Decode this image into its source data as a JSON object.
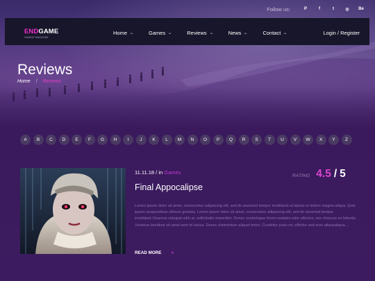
{
  "social": {
    "follow_label": "Follow us:",
    "icons": [
      {
        "name": "pinterest-icon",
        "glyph": "P"
      },
      {
        "name": "facebook-icon",
        "glyph": "f"
      },
      {
        "name": "twitter-icon",
        "glyph": "t"
      },
      {
        "name": "dribbble-icon",
        "glyph": "◎"
      },
      {
        "name": "behance-icon",
        "glyph": "Be"
      }
    ]
  },
  "logo": {
    "end": "END",
    "game": "GAME",
    "tagline": "gaming magazine"
  },
  "nav": {
    "items": [
      "Home",
      "Games",
      "Reviews",
      "News",
      "Contact"
    ],
    "login": "Login / Register"
  },
  "page": {
    "title": "Reviews"
  },
  "breadcrumb": {
    "home": "Home",
    "separator": "/",
    "current": "Reviews"
  },
  "alphabet": [
    "A",
    "B",
    "C",
    "D",
    "E",
    "F",
    "G",
    "H",
    "I",
    "J",
    "K",
    "L",
    "M",
    "N",
    "O",
    "P",
    "Q",
    "R",
    "S",
    "T",
    "U",
    "V",
    "W",
    "X",
    "Y",
    "Z"
  ],
  "review": {
    "date": "11.11.18",
    "in_label": " / in ",
    "category": "Games",
    "title": "Final Appocalipse",
    "rating_label": "RATING",
    "rating": "4.5",
    "rating_sep": "/",
    "rating_max": "5",
    "excerpt": "Lorem ipsum dolor sit amet, consectetur adipiscing elit, sed do eiusmod tempor incididunt ut labore et dolore magna aliqua. Quis ipsum suspendisse ultrices gravida. Lorem ipsum dolor sit amet, consectetur adipiscing elit, sed do eiusmod tempor incididunt.Vivamus volutpat nibh ac sollicitudin imperdiet. Donec scelerisque lorem sodales odio ultricies, nec rhoncus ex lobortis. Vivamus tincidunt sit amet sem id varius. Donec elementum aliquet tortor. Curabitur justo mi, efficitur sed eros aliquealiqua....",
    "read_more": "READ MORE",
    "read_more_arrow": "»"
  },
  "colors": {
    "accent": "#e53fc9",
    "nav_bg": "#17162a",
    "page_bg": "#3a1a5c",
    "letter_bg": "#4a3a63"
  }
}
